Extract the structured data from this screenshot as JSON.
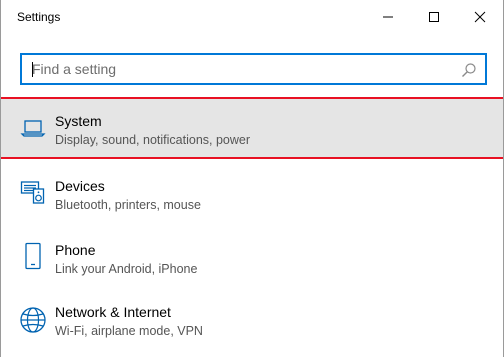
{
  "window": {
    "title": "Settings"
  },
  "search": {
    "placeholder": "Find a setting",
    "value": ""
  },
  "items": [
    {
      "title": "System",
      "subtitle": "Display, sound, notifications, power",
      "icon": "laptop-icon",
      "selected": true
    },
    {
      "title": "Devices",
      "subtitle": "Bluetooth, printers, mouse",
      "icon": "devices-icon",
      "selected": false
    },
    {
      "title": "Phone",
      "subtitle": "Link your Android, iPhone",
      "icon": "phone-icon",
      "selected": false
    },
    {
      "title": "Network & Internet",
      "subtitle": "Wi-Fi, airplane mode, VPN",
      "icon": "globe-icon",
      "selected": false
    }
  ],
  "colors": {
    "accent": "#0078d7",
    "selection_outline": "#e81123",
    "selected_bg": "#e5e5e5"
  }
}
